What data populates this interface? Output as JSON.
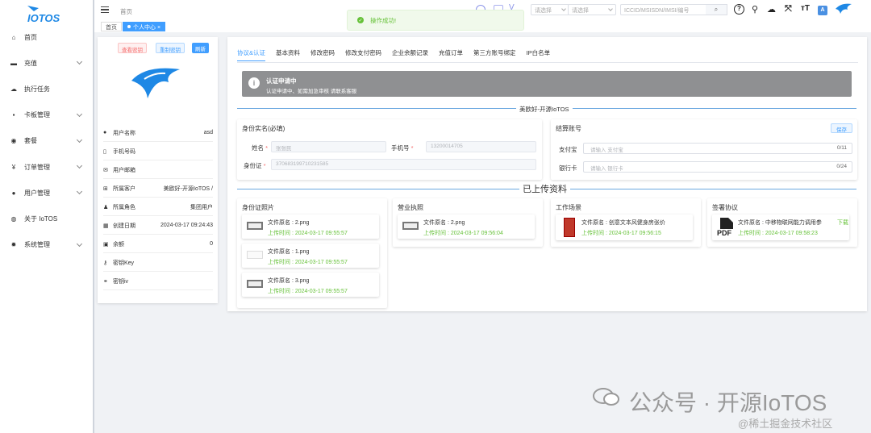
{
  "sidebar": {
    "logo_text": "IOTOS",
    "items": [
      {
        "label": "首页",
        "icon": "home-icon",
        "expandable": false
      },
      {
        "label": "充值",
        "icon": "cart-icon",
        "expandable": true
      },
      {
        "label": "执行任务",
        "icon": "cloud-icon",
        "expandable": false
      },
      {
        "label": "卡板管理",
        "icon": "card-icon",
        "expandable": true
      },
      {
        "label": "套餐",
        "icon": "package-icon",
        "expandable": true
      },
      {
        "label": "订单管理",
        "icon": "yen-icon",
        "expandable": true
      },
      {
        "label": "用户管理",
        "icon": "user-icon",
        "expandable": true
      },
      {
        "label": "关于 IoTOS",
        "icon": "globe-icon",
        "expandable": false
      },
      {
        "label": "系统管理",
        "icon": "gear-icon",
        "expandable": true
      }
    ]
  },
  "topbar": {
    "breadcrumb": "首页",
    "select1_placeholder": "请选择",
    "select2_placeholder": "请选择",
    "search_placeholder": "ICCID/MSISDN/IMSI/编号",
    "right_icons": [
      "help-icon",
      "search-icon",
      "cloud-download-icon",
      "fullscreen-icon",
      "font-size-icon",
      "translate-icon",
      "avatar-icon"
    ]
  },
  "tags": {
    "home": "首页",
    "active": "个人中心"
  },
  "toast": {
    "message": "操作成功!"
  },
  "profile": {
    "btn_view_key": "查看密钥",
    "btn_reset_key": "重制密钥",
    "btn_refresh": "刷新",
    "rows": [
      {
        "icon": "user-icon",
        "label": "用户名称",
        "value": "asd"
      },
      {
        "icon": "phone-icon",
        "label": "手机号码",
        "value": ""
      },
      {
        "icon": "mail-icon",
        "label": "用户邮箱",
        "value": ""
      },
      {
        "icon": "tree-icon",
        "label": "所属客户",
        "value": "美欧好-开源IoTOS /"
      },
      {
        "icon": "role-icon",
        "label": "所属角色",
        "value": "集团用户"
      },
      {
        "icon": "calendar-icon",
        "label": "创建日期",
        "value": "2024-03-17 09:24:43"
      },
      {
        "icon": "wallet-icon",
        "label": "余额",
        "value": "0"
      },
      {
        "icon": "key-icon",
        "label": "密钥Key",
        "value": ""
      },
      {
        "icon": "link-icon",
        "label": "密钥iv",
        "value": ""
      }
    ]
  },
  "tabs": [
    "协议&认证",
    "基本资料",
    "修改密码",
    "修改支付密码",
    "企业余额记录",
    "充值订单",
    "第三方账号绑定",
    "IP白名单"
  ],
  "alert": {
    "title": "认证申请中",
    "desc": "认证申请中、如需加急审核 请联系客服"
  },
  "company_divider": "美欧好-开源IoTOS",
  "identity": {
    "title": "身份实名(必填)",
    "name_label": "姓名",
    "name_value": "张张民",
    "phone_label": "手机号",
    "phone_value": "13200014705",
    "idcard_label": "身份证",
    "idcard_value": "370683199710231585"
  },
  "settlement": {
    "title": "结算账号",
    "save": "保存",
    "alipay_label": "支付宝",
    "alipay_placeholder": "请输入 支付宝",
    "alipay_count": "0/11",
    "bank_label": "银行卡",
    "bank_placeholder": "请输入 银行卡",
    "bank_count": "0/24"
  },
  "uploaded_divider": "已上传资料",
  "upload_groups": [
    {
      "title": "身份证照片",
      "files": [
        {
          "name": "文件原名 : 2.png",
          "time": "上传时间 : 2024-03-17 09:55:57",
          "thumb": "image"
        },
        {
          "name": "文件原名 : 1.png",
          "time": "上传时间 : 2024-03-17 09:55:57",
          "thumb": "blank"
        },
        {
          "name": "文件原名 : 3.png",
          "time": "上传时间 : 2024-03-17 09:55:57",
          "thumb": "image"
        }
      ]
    },
    {
      "title": "营业执照",
      "files": [
        {
          "name": "文件原名 : 2.png",
          "time": "上传时间 : 2024-03-17 09:56:04",
          "thumb": "image"
        }
      ]
    },
    {
      "title": "工作场景",
      "files": [
        {
          "name": "文件原名 : 创意文本风健身房张价",
          "time": "上传时间 : 2024-03-17 09:56:15",
          "thumb": "red"
        }
      ]
    },
    {
      "title": "签署协议",
      "files": [
        {
          "name": "文件原名 : 中移物联网能力调用参",
          "time": "上传时间 : 2024-03-17 09:58:23",
          "thumb": "pdf",
          "action": "下载"
        }
      ]
    }
  ],
  "watermark": {
    "main": "公众号 · 开源IoTOS",
    "sub": "@稀土掘金技术社区"
  },
  "colors": {
    "primary": "#409eff",
    "success": "#67c23a",
    "danger": "#f56c6c",
    "alert_bg": "#8f9092",
    "divider": "#6ba8e0"
  }
}
